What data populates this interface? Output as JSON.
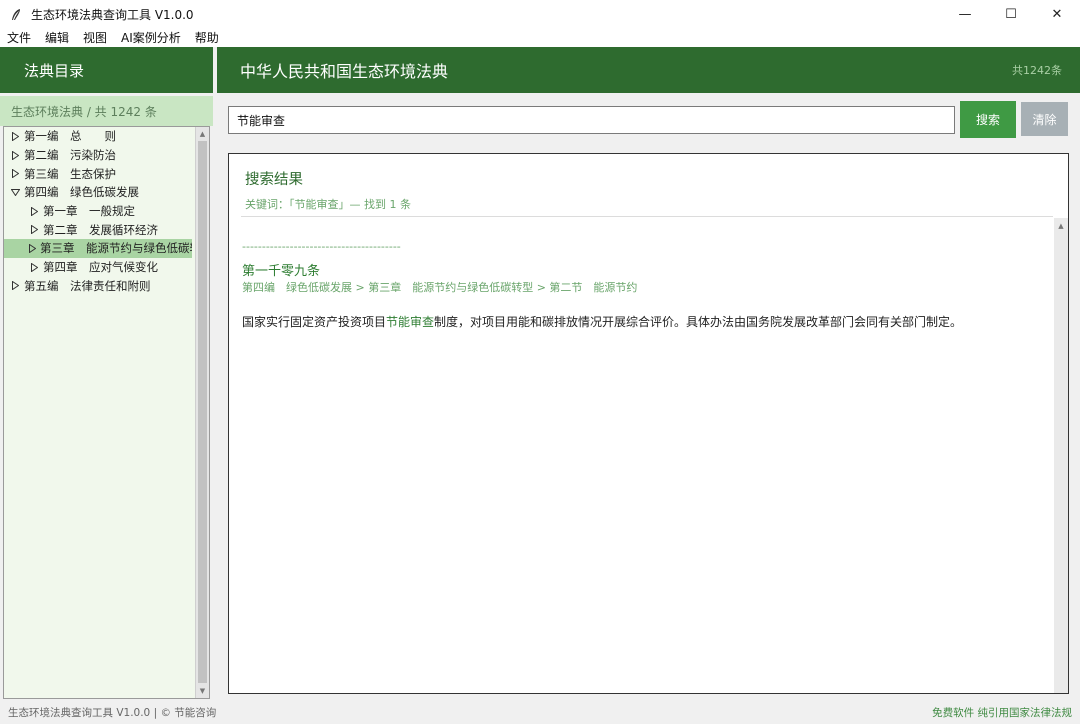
{
  "window": {
    "title": "生态环境法典查询工具 V1.0.0",
    "minimize": "—",
    "maximize": "☐",
    "close": "✕"
  },
  "menu": [
    "文件",
    "编辑",
    "视图",
    "AI案例分析",
    "帮助"
  ],
  "sidebar": {
    "header": "法典目录",
    "subheader": "生态环境法典 / 共 1242 条",
    "tree": [
      {
        "label": "第一编　总　　则",
        "level": 1,
        "expanded": false
      },
      {
        "label": "第二编　污染防治",
        "level": 1,
        "expanded": false
      },
      {
        "label": "第三编　生态保护",
        "level": 1,
        "expanded": false
      },
      {
        "label": "第四编　绿色低碳发展",
        "level": 1,
        "expanded": true
      },
      {
        "label": "第一章　一般规定",
        "level": 2,
        "expanded": false
      },
      {
        "label": "第二章　发展循环经济",
        "level": 2,
        "expanded": false
      },
      {
        "label": "第三章　能源节约与绿色低碳转型",
        "level": 2,
        "expanded": false,
        "selected": true
      },
      {
        "label": "第四章　应对气候变化",
        "level": 2,
        "expanded": false
      },
      {
        "label": "第五编　法律责任和附则",
        "level": 1,
        "expanded": false
      }
    ]
  },
  "main": {
    "title": "中华人民共和国生态环境法典",
    "count": "共1242条",
    "search": {
      "value": "节能审查",
      "search_label": "搜索",
      "clear_label": "清除"
    },
    "results": {
      "title": "搜索结果",
      "keyword_line": "关键词：「节能审查」— 找到 1 条",
      "separator": "----------------------------------------",
      "article_title": "第一千零九条",
      "article_path": "第四编　绿色低碳发展 > 第三章　能源节约与绿色低碳转型 > 第二节　能源节约",
      "body_before": "国家实行固定资产投资项目",
      "body_highlight": "节能审查",
      "body_after": "制度，对项目用能和碳排放情况开展综合评价。具体办法由国务院发展改革部门会同有关部门制定。"
    }
  },
  "status": {
    "left": "生态环境法典查询工具 V1.0.0 | © 节能咨询",
    "right": "免费软件 纯引用国家法律法规"
  },
  "colors": {
    "brand_green": "#2e6b2f",
    "accent_green": "#3f9a44",
    "selected_row": "#a9d4a3"
  }
}
